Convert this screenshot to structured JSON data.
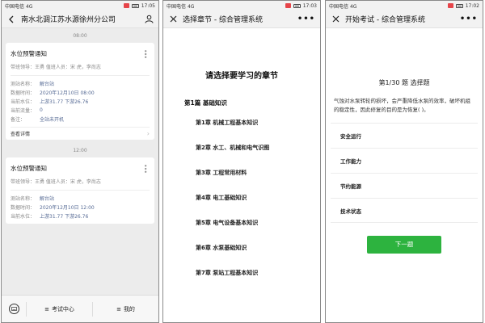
{
  "screens": [
    {
      "status": {
        "carrier": "中国电信",
        "net": "4G",
        "battery": "",
        "time": "17:05"
      },
      "header": {
        "title": "南水北调江苏水源徐州分公司"
      },
      "timestamps": [
        "08:00",
        "12:00"
      ],
      "cards": [
        {
          "title": "水位预警通知",
          "duty": "带班领导：王勇  值班人员：宋  虎，李尚志",
          "rows": [
            {
              "k": "测站名称：",
              "v": "解台站"
            },
            {
              "k": "数据时间：",
              "v": "2020年12月10日 08:00"
            },
            {
              "k": "当前水位：",
              "v": "上游31.77  下游26.76"
            },
            {
              "k": "当前流量：",
              "v": "0"
            },
            {
              "k": "备注：",
              "v": "全站未开机"
            }
          ],
          "footer": "查看详情"
        },
        {
          "title": "水位预警通知",
          "duty": "带班领导：王勇  值班人员：宋  虎，李尚志",
          "rows": [
            {
              "k": "测站名称：",
              "v": "解台站"
            },
            {
              "k": "数据时间：",
              "v": "2020年12月10日 12:00"
            },
            {
              "k": "当前水位：",
              "v": "上游31.77  下游26.76"
            }
          ]
        }
      ],
      "tabbar": {
        "tab1": "考试中心",
        "tab2": "我的"
      }
    },
    {
      "status": {
        "carrier": "中国电信",
        "net": "4G",
        "time": "17:03"
      },
      "header": {
        "title": "选择章节 - 综合管理系统",
        "more": "•••"
      },
      "bigtitle": "请选择要学习的章节",
      "part": "第1篇 基础知识",
      "chapters": [
        "第1章 机械工程基本知识",
        "第2章 水工、机械和电气识图",
        "第3章 工程常用材料",
        "第4章 电工基础知识",
        "第5章 电气设备基本知识",
        "第6章 水泵基础知识",
        "第7章 泵站工程基本知识"
      ]
    },
    {
      "status": {
        "carrier": "中国电信",
        "net": "4G",
        "time": "17:02"
      },
      "header": {
        "title": "开始考试 - 综合管理系统",
        "more": "•••"
      },
      "qnum": "第1/30 题 选择题",
      "question": "气蚀对水泵转轮的损坏，会严重降低水泵的效率，破坏机组的稳定性，因此修复的目的是为恢复(   )。",
      "options": [
        "安全运行",
        "工作能力",
        "节约能源",
        "技术状态"
      ],
      "next": "下一题"
    }
  ],
  "colors": {
    "accent": "#2db33f",
    "link": "#576b95",
    "feed_bg": "#ececec"
  }
}
